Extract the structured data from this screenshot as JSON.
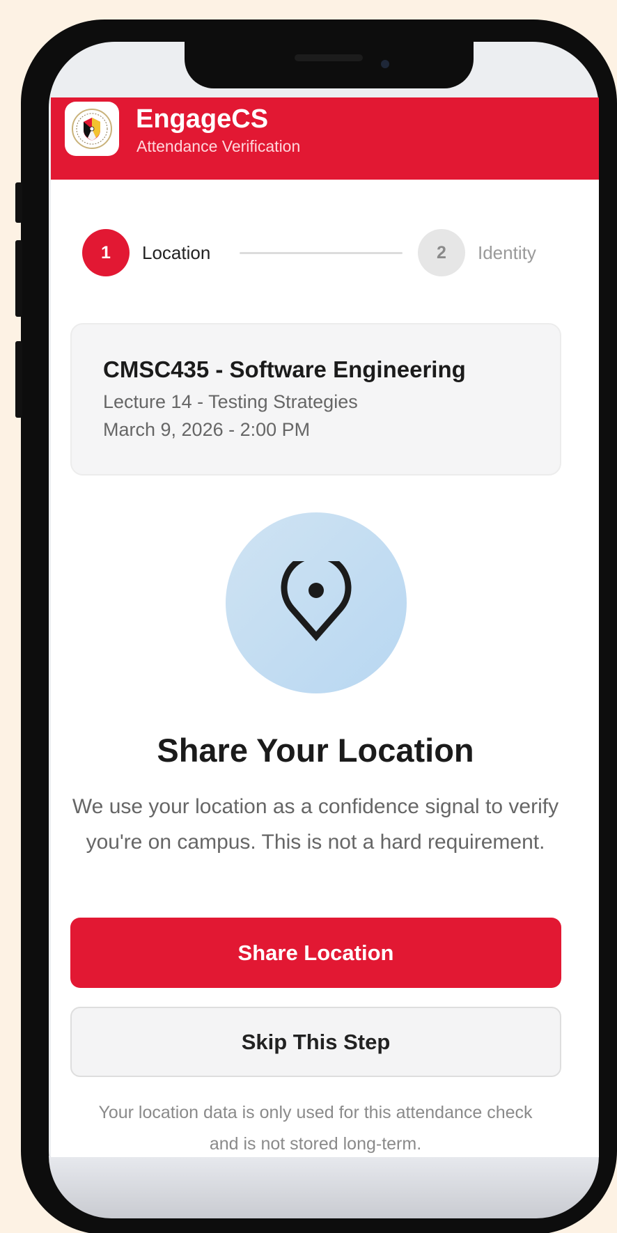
{
  "header": {
    "app_name": "EngageCS",
    "subtitle": "Attendance Verification",
    "logo_icon": "university-seal-icon"
  },
  "stepper": {
    "steps": [
      {
        "number": "1",
        "label": "Location",
        "state": "active"
      },
      {
        "number": "2",
        "label": "Identity",
        "state": "inactive"
      }
    ]
  },
  "course": {
    "title": "CMSC435 - Software Engineering",
    "lecture": "Lecture 14 - Testing Strategies",
    "datetime": "March 9, 2026 - 2:00 PM"
  },
  "location_prompt": {
    "icon": "location-pin-icon",
    "headline": "Share Your Location",
    "description": "We use your location as a confidence signal to verify you're on campus. This is not a hard requirement."
  },
  "actions": {
    "primary_label": "Share Location",
    "secondary_label": "Skip This Step"
  },
  "footnote": "Your location data is only used for this attendance check and is not stored long-term.",
  "colors": {
    "brand_red": "#e21833",
    "card_background": "#f5f5f6",
    "pin_circle": "#c4ddf2",
    "text_dark": "#1b1b1b",
    "text_muted": "#666666"
  }
}
